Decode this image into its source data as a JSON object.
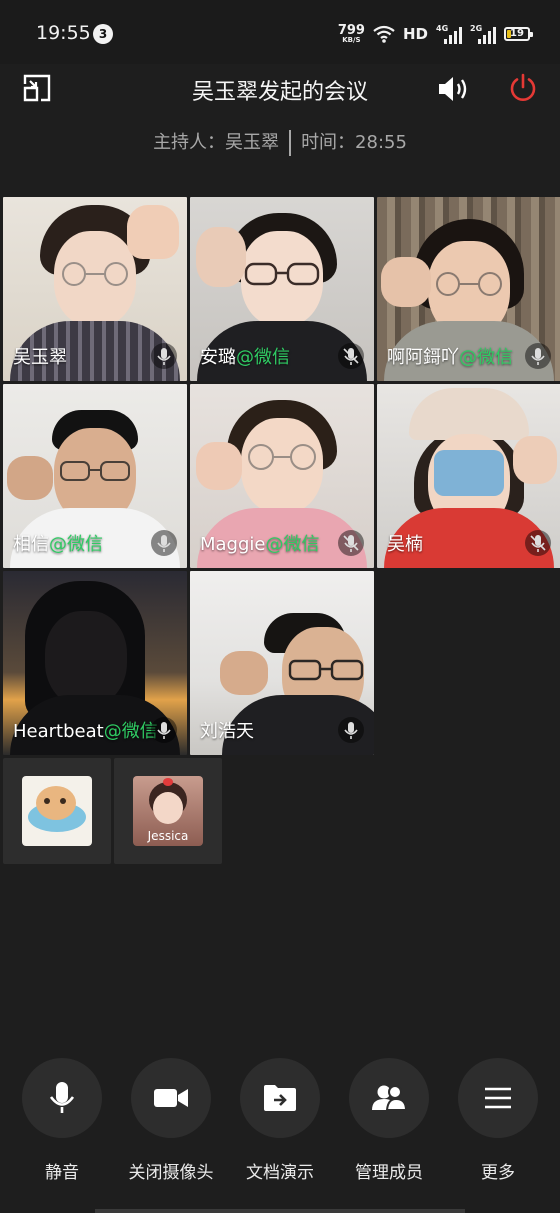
{
  "status_bar": {
    "time": "19:55",
    "notification_count": "3",
    "net_speed": "799",
    "net_speed_unit": "KB/S",
    "hd_label": "HD",
    "sim1_label": "4G",
    "sim2_label": "2G",
    "battery": "19",
    "icons": [
      "wifi-icon",
      "signal-4g-icon",
      "signal-2g-icon",
      "battery-icon"
    ]
  },
  "header": {
    "title": "吴玉翠发起的会议",
    "host_label": "主持人：吴玉翠",
    "time_label": "时间：28:55",
    "icons": [
      "minimize-window-icon",
      "speaker-icon",
      "power-icon"
    ],
    "accent_color": "#e53935"
  },
  "participants": [
    {
      "name": "吴玉翠",
      "suffix": ""
    },
    {
      "name": "安璐",
      "suffix": "@微信"
    },
    {
      "name": "啊阿鎶吖",
      "suffix": "@微信"
    },
    {
      "name": "相信",
      "suffix": "@微信"
    },
    {
      "name": "Maggie",
      "suffix": "@微信"
    },
    {
      "name": "吴楠",
      "suffix": ""
    },
    {
      "name": "Heartbeat",
      "suffix": "@微信"
    },
    {
      "name": "刘浩天",
      "suffix": ""
    }
  ],
  "audio_participants": [
    {
      "label": ""
    },
    {
      "label": "Jessica"
    }
  ],
  "toolbar": {
    "items": [
      {
        "label": "静音",
        "icon": "microphone-icon"
      },
      {
        "label": "关闭摄像头",
        "icon": "video-camera-icon"
      },
      {
        "label": "文档演示",
        "icon": "folder-share-icon"
      },
      {
        "label": "管理成员",
        "icon": "members-icon"
      },
      {
        "label": "更多",
        "icon": "menu-icon"
      }
    ]
  },
  "colors": {
    "background": "#1e1e1e",
    "wechat_green": "#2fcb63",
    "battery_yellow": "#e8c11a"
  }
}
